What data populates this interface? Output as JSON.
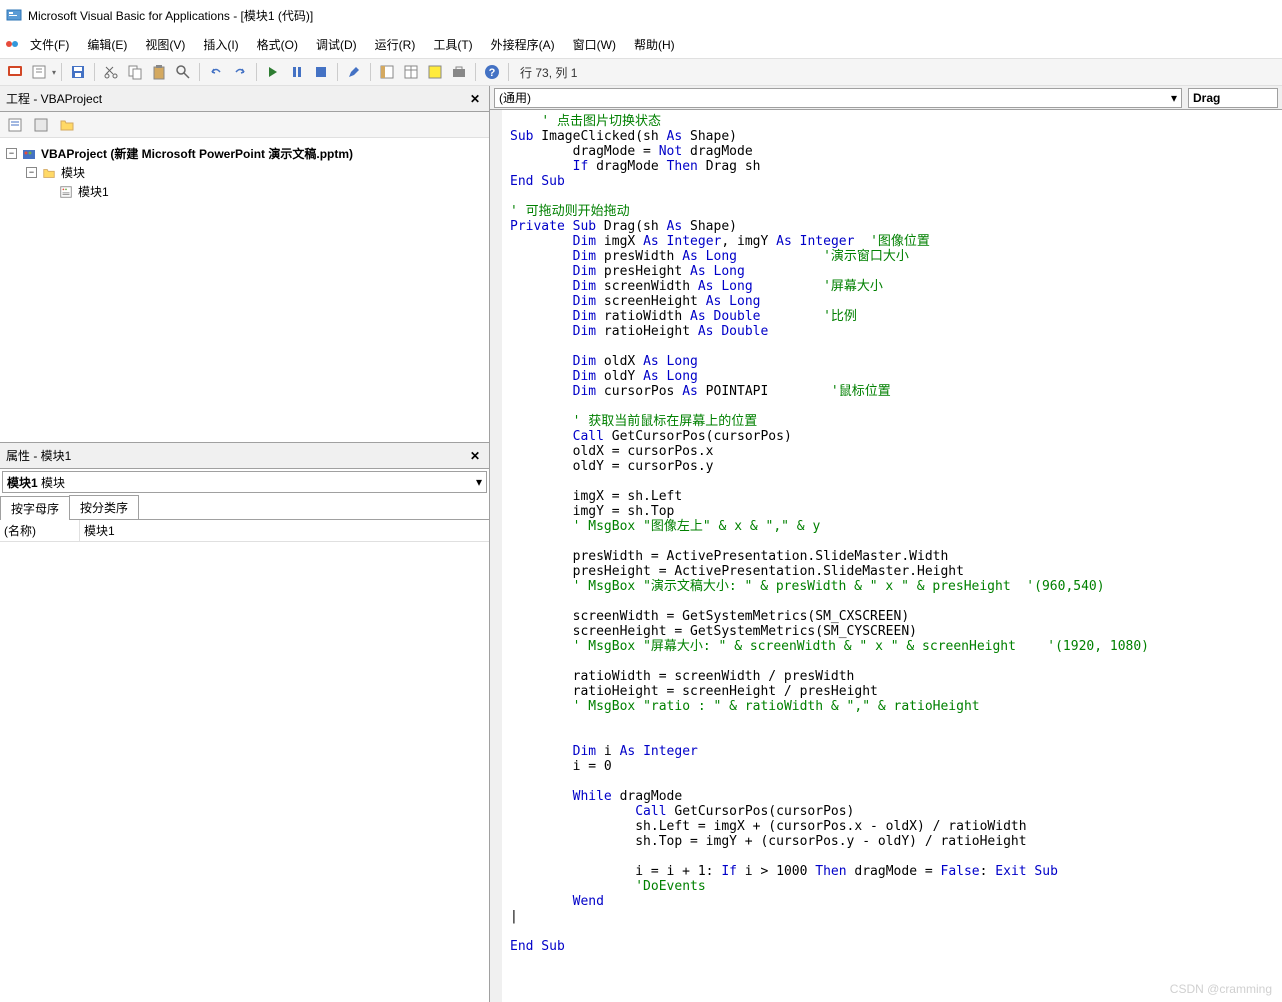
{
  "window": {
    "title": "Microsoft Visual Basic for Applications - [模块1 (代码)]"
  },
  "menu": {
    "file": "文件(F)",
    "edit": "编辑(E)",
    "view": "视图(V)",
    "insert": "插入(I)",
    "format": "格式(O)",
    "debug": "调试(D)",
    "run": "运行(R)",
    "tools": "工具(T)",
    "addins": "外接程序(A)",
    "window": "窗口(W)",
    "help": "帮助(H)"
  },
  "toolbar": {
    "status": "行 73, 列 1"
  },
  "project_panel": {
    "title": "工程 - VBAProject",
    "root": "VBAProject (新建 Microsoft PowerPoint 演示文稿.pptm)",
    "modules_folder": "模块",
    "module1": "模块1"
  },
  "properties_panel": {
    "title": "属性 - 模块1",
    "obj_name": "模块1",
    "obj_type": "模块",
    "tab_alpha": "按字母序",
    "tab_cat": "按分类序",
    "rows": [
      {
        "name": "(名称)",
        "value": "模块1"
      }
    ]
  },
  "code_header": {
    "left_dropdown": "(通用)",
    "right_dropdown": "Drag"
  },
  "code": {
    "lines": [
      {
        "i": 1,
        "t": "cm",
        "s": "' 点击图片切换状态"
      },
      {
        "i": 0,
        "p": [
          {
            "t": "kw",
            "s": "Sub"
          },
          {
            "t": "",
            "s": " ImageClicked(sh "
          },
          {
            "t": "kw",
            "s": "As"
          },
          {
            "t": "",
            "s": " Shape)"
          }
        ]
      },
      {
        "i": 2,
        "p": [
          {
            "t": "",
            "s": "dragMode = "
          },
          {
            "t": "kw",
            "s": "Not"
          },
          {
            "t": "",
            "s": " dragMode"
          }
        ]
      },
      {
        "i": 2,
        "p": [
          {
            "t": "kw",
            "s": "If"
          },
          {
            "t": "",
            "s": " dragMode "
          },
          {
            "t": "kw",
            "s": "Then"
          },
          {
            "t": "",
            "s": " Drag sh"
          }
        ]
      },
      {
        "i": 0,
        "t": "kw",
        "s": "End Sub"
      },
      {
        "i": 0,
        "s": ""
      },
      {
        "i": 0,
        "t": "cm",
        "s": "' 可拖动则开始拖动"
      },
      {
        "i": 0,
        "p": [
          {
            "t": "kw",
            "s": "Private Sub"
          },
          {
            "t": "",
            "s": " Drag(sh "
          },
          {
            "t": "kw",
            "s": "As"
          },
          {
            "t": "",
            "s": " Shape)"
          }
        ]
      },
      {
        "i": 2,
        "p": [
          {
            "t": "kw",
            "s": "Dim"
          },
          {
            "t": "",
            "s": " imgX "
          },
          {
            "t": "kw",
            "s": "As Integer"
          },
          {
            "t": "",
            "s": ", imgY "
          },
          {
            "t": "kw",
            "s": "As Integer"
          },
          {
            "t": "",
            "s": "  "
          },
          {
            "t": "cm",
            "s": "'图像位置"
          }
        ]
      },
      {
        "i": 2,
        "p": [
          {
            "t": "kw",
            "s": "Dim"
          },
          {
            "t": "",
            "s": " presWidth "
          },
          {
            "t": "kw",
            "s": "As Long"
          },
          {
            "t": "",
            "s": "           "
          },
          {
            "t": "cm",
            "s": "'演示窗口大小"
          }
        ]
      },
      {
        "i": 2,
        "p": [
          {
            "t": "kw",
            "s": "Dim"
          },
          {
            "t": "",
            "s": " presHeight "
          },
          {
            "t": "kw",
            "s": "As Long"
          }
        ]
      },
      {
        "i": 2,
        "p": [
          {
            "t": "kw",
            "s": "Dim"
          },
          {
            "t": "",
            "s": " screenWidth "
          },
          {
            "t": "kw",
            "s": "As Long"
          },
          {
            "t": "",
            "s": "         "
          },
          {
            "t": "cm",
            "s": "'屏幕大小"
          }
        ]
      },
      {
        "i": 2,
        "p": [
          {
            "t": "kw",
            "s": "Dim"
          },
          {
            "t": "",
            "s": " screenHeight "
          },
          {
            "t": "kw",
            "s": "As Long"
          }
        ]
      },
      {
        "i": 2,
        "p": [
          {
            "t": "kw",
            "s": "Dim"
          },
          {
            "t": "",
            "s": " ratioWidth "
          },
          {
            "t": "kw",
            "s": "As Double"
          },
          {
            "t": "",
            "s": "        "
          },
          {
            "t": "cm",
            "s": "'比例"
          }
        ]
      },
      {
        "i": 2,
        "p": [
          {
            "t": "kw",
            "s": "Dim"
          },
          {
            "t": "",
            "s": " ratioHeight "
          },
          {
            "t": "kw",
            "s": "As Double"
          }
        ]
      },
      {
        "i": 0,
        "s": ""
      },
      {
        "i": 2,
        "p": [
          {
            "t": "kw",
            "s": "Dim"
          },
          {
            "t": "",
            "s": " oldX "
          },
          {
            "t": "kw",
            "s": "As Long"
          }
        ]
      },
      {
        "i": 2,
        "p": [
          {
            "t": "kw",
            "s": "Dim"
          },
          {
            "t": "",
            "s": " oldY "
          },
          {
            "t": "kw",
            "s": "As Long"
          }
        ]
      },
      {
        "i": 2,
        "p": [
          {
            "t": "kw",
            "s": "Dim"
          },
          {
            "t": "",
            "s": " cursorPos "
          },
          {
            "t": "kw",
            "s": "As"
          },
          {
            "t": "",
            "s": " POINTAPI        "
          },
          {
            "t": "cm",
            "s": "'鼠标位置"
          }
        ]
      },
      {
        "i": 0,
        "s": ""
      },
      {
        "i": 2,
        "t": "cm",
        "s": "' 获取当前鼠标在屏幕上的位置"
      },
      {
        "i": 2,
        "p": [
          {
            "t": "kw",
            "s": "Call"
          },
          {
            "t": "",
            "s": " GetCursorPos(cursorPos)"
          }
        ]
      },
      {
        "i": 2,
        "s": "oldX = cursorPos.x"
      },
      {
        "i": 2,
        "s": "oldY = cursorPos.y"
      },
      {
        "i": 0,
        "s": ""
      },
      {
        "i": 2,
        "s": "imgX = sh.Left"
      },
      {
        "i": 2,
        "s": "imgY = sh.Top"
      },
      {
        "i": 2,
        "t": "cm",
        "s": "' MsgBox \"图像左上\" & x & \",\" & y"
      },
      {
        "i": 0,
        "s": ""
      },
      {
        "i": 2,
        "s": "presWidth = ActivePresentation.SlideMaster.Width"
      },
      {
        "i": 2,
        "s": "presHeight = ActivePresentation.SlideMaster.Height"
      },
      {
        "i": 2,
        "t": "cm",
        "s": "' MsgBox \"演示文稿大小: \" & presWidth & \" x \" & presHeight  '(960,540)"
      },
      {
        "i": 0,
        "s": ""
      },
      {
        "i": 2,
        "s": "screenWidth = GetSystemMetrics(SM_CXSCREEN)"
      },
      {
        "i": 2,
        "s": "screenHeight = GetSystemMetrics(SM_CYSCREEN)"
      },
      {
        "i": 2,
        "t": "cm",
        "s": "' MsgBox \"屏幕大小: \" & screenWidth & \" x \" & screenHeight    '(1920, 1080)"
      },
      {
        "i": 0,
        "s": ""
      },
      {
        "i": 2,
        "s": "ratioWidth = screenWidth / presWidth"
      },
      {
        "i": 2,
        "s": "ratioHeight = screenHeight / presHeight"
      },
      {
        "i": 2,
        "t": "cm",
        "s": "' MsgBox \"ratio : \" & ratioWidth & \",\" & ratioHeight"
      },
      {
        "i": 0,
        "s": ""
      },
      {
        "i": 0,
        "s": ""
      },
      {
        "i": 2,
        "p": [
          {
            "t": "kw",
            "s": "Dim"
          },
          {
            "t": "",
            "s": " i "
          },
          {
            "t": "kw",
            "s": "As Integer"
          }
        ]
      },
      {
        "i": 2,
        "s": "i = 0"
      },
      {
        "i": 0,
        "s": ""
      },
      {
        "i": 2,
        "p": [
          {
            "t": "kw",
            "s": "While"
          },
          {
            "t": "",
            "s": " dragMode"
          }
        ]
      },
      {
        "i": 4,
        "p": [
          {
            "t": "kw",
            "s": "Call"
          },
          {
            "t": "",
            "s": " GetCursorPos(cursorPos)"
          }
        ]
      },
      {
        "i": 4,
        "s": "sh.Left = imgX + (cursorPos.x - oldX) / ratioWidth"
      },
      {
        "i": 4,
        "s": "sh.Top = imgY + (cursorPos.y - oldY) / ratioHeight"
      },
      {
        "i": 0,
        "s": ""
      },
      {
        "i": 4,
        "p": [
          {
            "t": "",
            "s": "i = i + 1: "
          },
          {
            "t": "kw",
            "s": "If"
          },
          {
            "t": "",
            "s": " i > 1000 "
          },
          {
            "t": "kw",
            "s": "Then"
          },
          {
            "t": "",
            "s": " dragMode = "
          },
          {
            "t": "kw",
            "s": "False"
          },
          {
            "t": "",
            "s": ": "
          },
          {
            "t": "kw",
            "s": "Exit Sub"
          }
        ]
      },
      {
        "i": 4,
        "t": "cm",
        "s": "'DoEvents"
      },
      {
        "i": 2,
        "t": "kw",
        "s": "Wend"
      },
      {
        "i": 0,
        "s": "|"
      },
      {
        "i": 0,
        "s": ""
      },
      {
        "i": 0,
        "t": "kw",
        "s": "End Sub"
      }
    ]
  },
  "watermark": "CSDN @cramming"
}
